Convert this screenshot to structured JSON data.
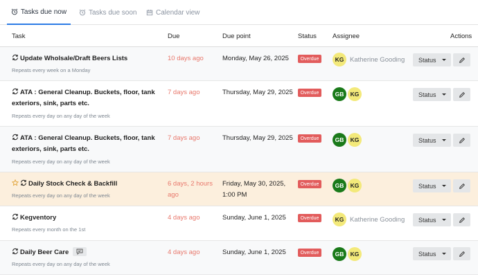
{
  "tabs": [
    {
      "label": "Tasks due now",
      "icon": "alarm-clock-icon",
      "active": true
    },
    {
      "label": "Tasks due soon",
      "icon": "alarm-clock-icon",
      "active": false
    },
    {
      "label": "Calendar view",
      "icon": "calendar-icon",
      "active": false
    }
  ],
  "columns": {
    "task": "Task",
    "due": "Due",
    "due_point": "Due point",
    "status": "Status",
    "assignee": "Assignee",
    "actions": "Actions"
  },
  "rows": [
    {
      "title": "Update Wholsale/Draft Beers Lists",
      "title_line2": "",
      "repeat": "Repeats every week on a Monday",
      "due": "10 days ago",
      "due2": "",
      "due_point": "Monday, May 26, 2025",
      "due_point2": "",
      "status": "Overdue",
      "assignees": [
        "KG"
      ],
      "assignee_name": "Katherine Gooding",
      "status_label": "Status"
    },
    {
      "title": "ATA : General Cleanup. Buckets, floor, tank",
      "title_line2": "exteriors, sink, parts etc.",
      "repeat": "Repeats every day on any day of the week",
      "due": "7 days ago",
      "due2": "",
      "due_point": "Thursday, May 29, 2025",
      "due_point2": "",
      "status": "Overdue",
      "assignees": [
        "GB",
        "KG"
      ],
      "assignee_name": "",
      "status_label": "Status"
    },
    {
      "title": "ATA : General Cleanup. Buckets, floor, tank",
      "title_line2": "exteriors, sink, parts etc.",
      "repeat": "Repeats every day on any day of the week",
      "due": "7 days ago",
      "due2": "",
      "due_point": "Thursday, May 29, 2025",
      "due_point2": "",
      "status": "Overdue",
      "assignees": [
        "GB",
        "KG"
      ],
      "assignee_name": "",
      "status_label": "Status"
    },
    {
      "title": "Daily Stock Check & Backfill",
      "title_line2": "",
      "repeat": "Repeats every day on any day of the week",
      "due": "6 days, 2 hours",
      "due2": "ago",
      "due_point": "Friday, May 30, 2025,",
      "due_point2": "1:00 PM",
      "status": "Overdue",
      "assignees": [
        "GB",
        "KG"
      ],
      "assignee_name": "",
      "status_label": "Status",
      "starred": true
    },
    {
      "title": "Kegventory",
      "title_line2": "",
      "repeat": "Repeats every month on the 1st",
      "due": "4 days ago",
      "due2": "",
      "due_point": "Sunday, June 1, 2025",
      "due_point2": "",
      "status": "Overdue",
      "assignees": [
        "KG"
      ],
      "assignee_name": "Katherine Gooding",
      "status_label": "Status"
    },
    {
      "title": "Daily Beer Care",
      "title_line2": "",
      "repeat": "Repeats every day on any day of the week",
      "due": "4 days ago",
      "due2": "",
      "due_point": "Sunday, June 1, 2025",
      "due_point2": "",
      "status": "Overdue",
      "assignees": [
        "GB",
        "KG"
      ],
      "assignee_name": "",
      "status_label": "Status",
      "has_note": true
    }
  ],
  "colors": {
    "accent": "#2c7be5",
    "overdue": "#e25c5c",
    "due_text": "#e8786c",
    "avatar_kg": "#f3e97a",
    "avatar_gb": "#1a7a1a",
    "highlight_row": "#fcefdd"
  }
}
